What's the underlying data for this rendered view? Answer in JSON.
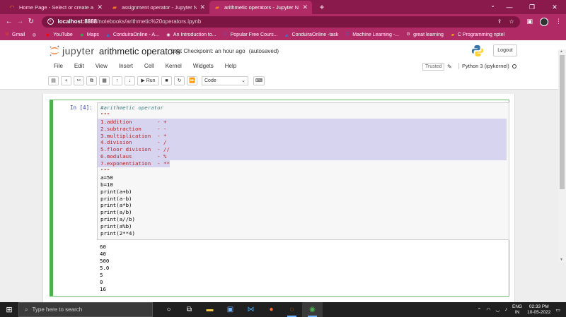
{
  "browser": {
    "tabs": [
      {
        "label": "Home Page - Select or create a n",
        "icon": "jupyter-icon",
        "active": false
      },
      {
        "label": "assignment operator - Jupyter N",
        "icon": "jupyter-notebook-icon",
        "active": false
      },
      {
        "label": "arithmetic operators - Jupyter N",
        "icon": "jupyter-notebook-icon",
        "active": true
      }
    ],
    "new_tab": "+",
    "address": {
      "host": "localhost:8888",
      "path": "/notebooks/arithmetic%20operators.ipynb"
    },
    "bookmarks": [
      {
        "label": "Gmail",
        "icon": "gmail-icon",
        "color": "#ea4335"
      },
      {
        "label": "",
        "icon": "chrome-icon",
        "color": "#ffffff"
      },
      {
        "label": "YouTube",
        "icon": "youtube-icon",
        "color": "#ff0000"
      },
      {
        "label": "Maps",
        "icon": "maps-icon",
        "color": "#34a853"
      },
      {
        "label": "ConduiraOnline - A...",
        "icon": "conduira-icon",
        "color": "#1e88e5"
      },
      {
        "label": "An Introduction to...",
        "icon": "doc-icon",
        "color": "#ffffff"
      },
      {
        "label": "Popular Free Cours...",
        "icon": "coursera-icon",
        "color": "#2a73cc"
      },
      {
        "label": "ConduiraOnline -task",
        "icon": "conduira-icon",
        "color": "#1e88e5"
      },
      {
        "label": "Machine Learning -...",
        "icon": "coursera-icon",
        "color": "#2a73cc"
      },
      {
        "label": "great learning",
        "icon": "google-icon",
        "color": "#ffffff"
      },
      {
        "label": "C Programming nptel",
        "icon": "bookmark-icon",
        "color": "#f4b400"
      }
    ]
  },
  "jupyter": {
    "logo_text": "jupyter",
    "notebook_name": "arithmetic operators",
    "checkpoint": "Last Checkpoint: an hour ago",
    "autosave": "(autosaved)",
    "logout": "Logout",
    "menu": [
      "File",
      "Edit",
      "View",
      "Insert",
      "Cell",
      "Kernel",
      "Widgets",
      "Help"
    ],
    "trusted": "Trusted",
    "kernel": "Python 3 (ipykernel)",
    "toolbar": {
      "run_label": "Run",
      "cell_type": "Code"
    }
  },
  "cell": {
    "prompt": "In [4]:",
    "code_lines": [
      {
        "text": "#arithmetic operator",
        "kind": "comment"
      },
      {
        "text": "\"\"\"",
        "kind": "str"
      },
      {
        "text": "1.addition        - +",
        "kind": "str-hl"
      },
      {
        "text": "2.subtraction     - -",
        "kind": "str-hl"
      },
      {
        "text": "3.multiplication  - *",
        "kind": "str-hl"
      },
      {
        "text": "4.division        - /",
        "kind": "str-hl"
      },
      {
        "text": "5.floor division  - //",
        "kind": "str-hl"
      },
      {
        "text": "6.modulaus        - %",
        "kind": "str-hl"
      },
      {
        "text": "7.exponentiation  - **",
        "kind": "str-hl-partial"
      },
      {
        "text": "\"\"\"",
        "kind": "str"
      },
      {
        "text": "a=50",
        "kind": "assign"
      },
      {
        "text": "b=10",
        "kind": "assign"
      },
      {
        "text": "print(a+b)",
        "kind": "code"
      },
      {
        "text": "print(a-b)",
        "kind": "code"
      },
      {
        "text": "print(a*b)",
        "kind": "code"
      },
      {
        "text": "print(a/b)",
        "kind": "code"
      },
      {
        "text": "print(a//b)",
        "kind": "code"
      },
      {
        "text": "print(a%b)",
        "kind": "code"
      },
      {
        "text": "print(2**4)",
        "kind": "code"
      }
    ],
    "output_lines": [
      "60",
      "40",
      "500",
      "5.0",
      "5",
      "0",
      "16"
    ]
  },
  "taskbar": {
    "search_placeholder": "Type here to search",
    "lang": [
      "ENG",
      "IN"
    ],
    "time": "02:33 PM",
    "date": "10-05-2022"
  }
}
